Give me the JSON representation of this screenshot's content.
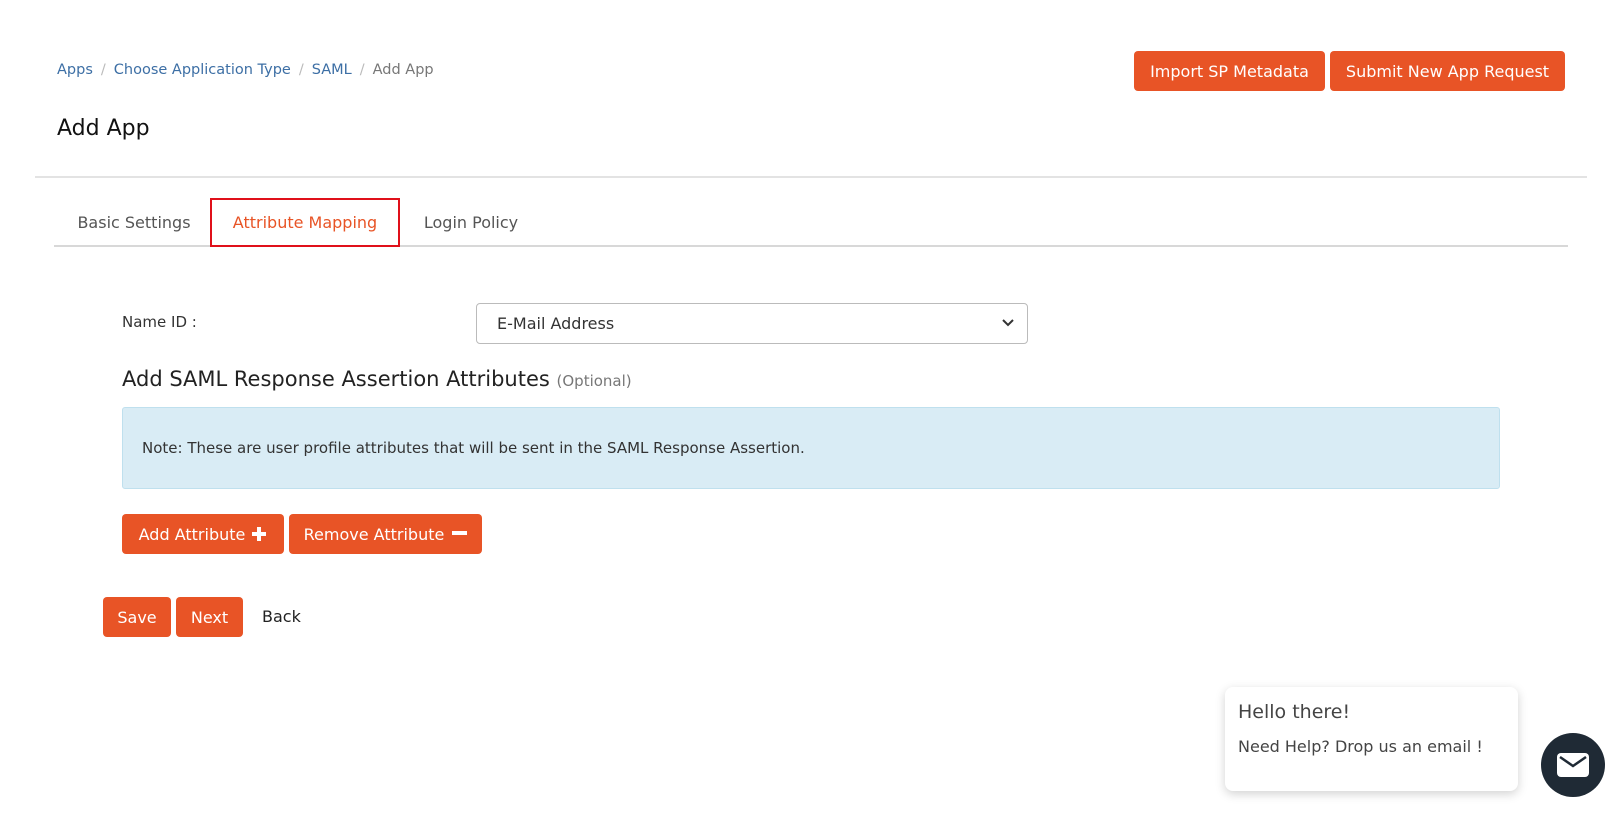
{
  "breadcrumb": [
    {
      "label": "Apps"
    },
    {
      "label": "Choose Application Type"
    },
    {
      "label": "SAML"
    },
    {
      "label": "Add App"
    }
  ],
  "breadcrumb_separator": "/",
  "header": {
    "import_label": "Import SP Metadata",
    "submit_label": "Submit New App Request",
    "title": "Add App"
  },
  "tabs": [
    {
      "label": "Basic Settings"
    },
    {
      "label": "Attribute Mapping",
      "active": true
    },
    {
      "label": "Login Policy"
    }
  ],
  "form": {
    "name_id_label": "Name ID :",
    "name_id_value": "E-Mail Address",
    "section_title": "Add SAML Response Assertion Attributes",
    "section_optional": "(Optional)",
    "note": "Note: These are user profile attributes that will be sent in the SAML Response Assertion.",
    "add_attribute": "Add Attribute",
    "remove_attribute": "Remove Attribute"
  },
  "actions": {
    "save": "Save",
    "next": "Next",
    "back": "Back"
  },
  "chat": {
    "greeting": "Hello there!",
    "message": "Need Help? Drop us an email !",
    "icon": "mail-icon"
  },
  "colors": {
    "accent": "#e85426",
    "link": "#3d6fa5",
    "active_tab_outline": "#e0101a",
    "note_bg": "#d9ecf5",
    "chat_button": "#1f2a35"
  }
}
